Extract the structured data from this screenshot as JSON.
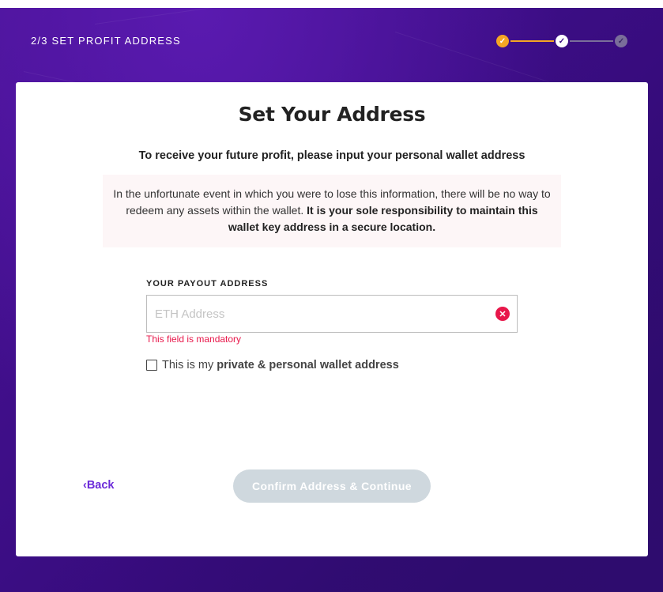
{
  "header": {
    "step_title": "2/3 SET PROFIT ADDRESS",
    "stepper": {
      "steps": [
        {
          "state": "completed",
          "color": "#f5a623"
        },
        {
          "state": "current",
          "color": "#ffffff"
        },
        {
          "state": "upcoming",
          "color": "#7a6e9a"
        }
      ],
      "check_glyph": "✓"
    }
  },
  "card": {
    "title": "Set Your Address",
    "subtitle": "To receive your future profit, please input your personal wallet address",
    "notice": {
      "text": "In the unfortunate event in which you were to lose this information, there will be no way to redeem any assets within the wallet.",
      "bold_text": "It is your sole responsibility to maintain this wallet key address in a secure location."
    },
    "payout_field": {
      "label": "YOUR PAYOUT ADDRESS",
      "placeholder": "ETH Address",
      "value": "",
      "clear_glyph": "✕",
      "error": "This field is mandatory"
    },
    "confirm_checkbox": {
      "checked": false,
      "label_prefix": "This is my",
      "label_bold": "private & personal wallet address"
    },
    "back_link": "‹Back",
    "confirm_button": "Confirm Address & Continue"
  },
  "colors": {
    "accent": "#6c2bd9",
    "error": "#e8174a",
    "step_done": "#f5a623",
    "button_disabled": "#cfd8de"
  }
}
